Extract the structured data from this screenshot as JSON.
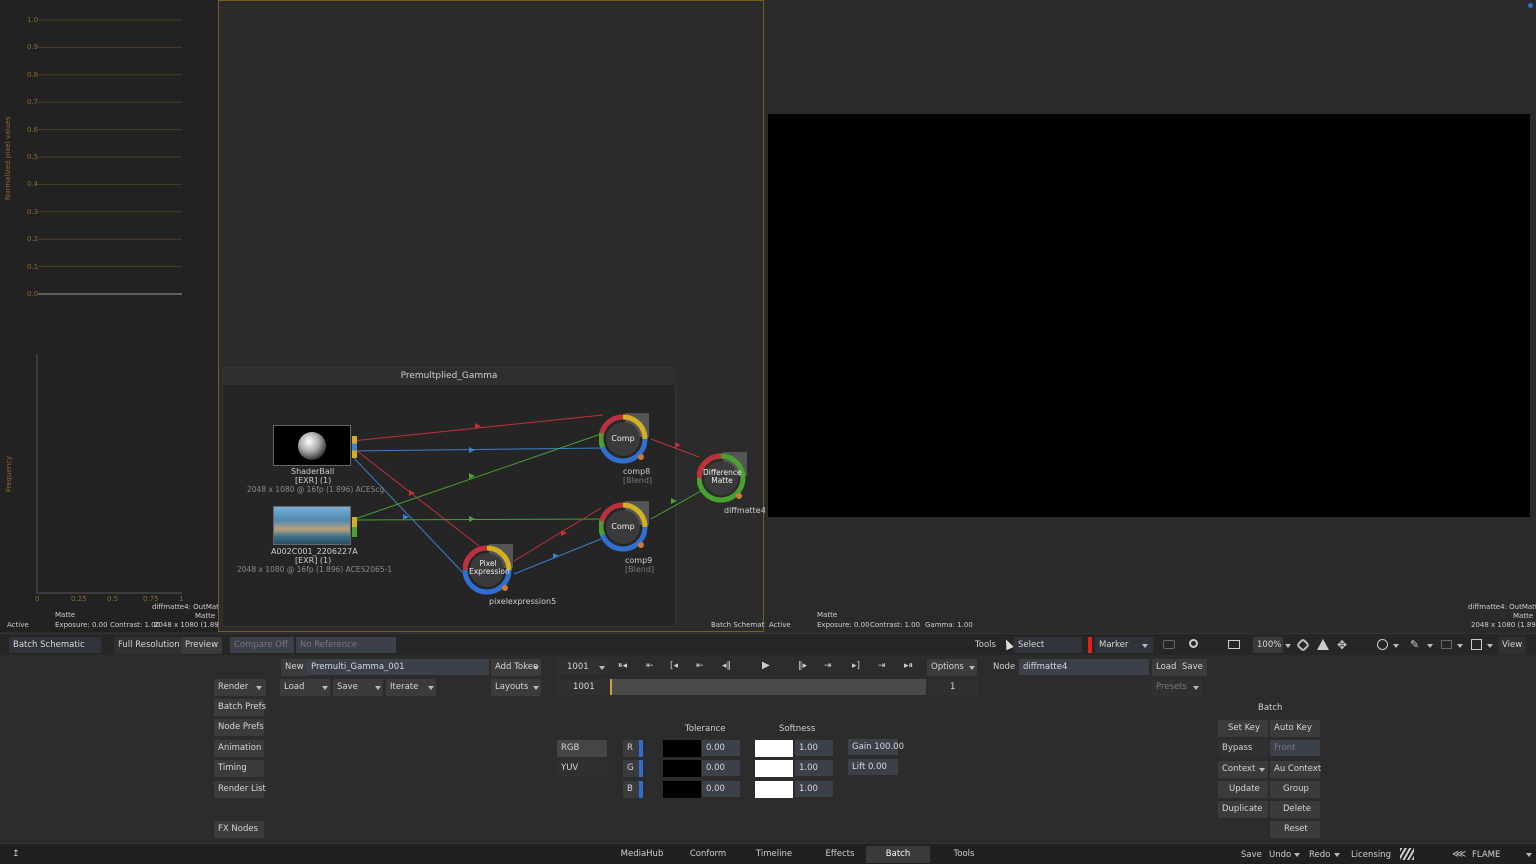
{
  "scopes": {
    "yaxis_title": "Normalized pixel values",
    "y_ticks": [
      "1.0",
      "0.9",
      "0.8",
      "0.7",
      "0.6",
      "0.5",
      "0.4",
      "0.3",
      "0.2",
      "0.1",
      "0.0"
    ],
    "freq_title": "Frequency",
    "x_ticks": [
      "0",
      "0.25",
      "0.5",
      "0.75",
      "1"
    ],
    "matte_label": "Matte",
    "node_info": "diffmatte4: OutMatte",
    "node_sub": "Matte",
    "status_active": "Active",
    "exposure": "Exposure: 0.00",
    "contrast": "Contrast: 1.00",
    "resolution": "2048 x 1080 (1.896)"
  },
  "schematic": {
    "group_title": "Premultplied_Gamma",
    "corner_label": "Batch Schematic",
    "nodes": {
      "shaderball": {
        "name": "ShaderBall",
        "format": "[EXR] (1)",
        "info": "2048 x 1080 @ 16fp (1.896) ACEScg"
      },
      "clip": {
        "name": "A002C001_2206227A",
        "format": "[EXR] (1)",
        "info": "2048 x 1080 @ 16fp (1.896) ACES2065-1"
      },
      "comp8": {
        "title": "Comp",
        "name": "comp8",
        "mode": "[Blend]"
      },
      "comp9": {
        "title": "Comp",
        "name": "comp9",
        "mode": "[Blend]"
      },
      "pixel": {
        "title": "Pixel Expression",
        "name": "pixelexpression5"
      },
      "diff": {
        "title": "Difference Matte",
        "name": "diffmatte4"
      }
    }
  },
  "viewer": {
    "status_active": "Active",
    "matte": "Matte",
    "exposure": "Exposure: 0.00",
    "contrast": "Contrast: 1.00",
    "gamma": "Gamma: 1.00",
    "node_info": "diffmatte4: OutMatte",
    "node_sub": "Matte",
    "resolution": "2048 x 1080 (1.896)"
  },
  "viewbar": {
    "batch_schematic": "Batch Schematic",
    "full_resolution": "Full Resolution",
    "preview": "Preview",
    "compare": "Compare Off",
    "reference": "No Reference",
    "tools": "Tools",
    "select": "Select",
    "marker": "Marker",
    "zoom": "100%",
    "view": "View"
  },
  "bottom": {
    "new": "New",
    "setup_name": "Premulti_Gamma_001",
    "add_token": "Add Token",
    "render": "Render",
    "load": "Load",
    "save": "Save",
    "iterate": "Iterate",
    "layouts": "Layouts",
    "frame": "1001",
    "frame_start": "1001",
    "frame_end": "1",
    "options": "Options",
    "node_label": "Node",
    "node_name": "diffmatte4",
    "node_load": "Load",
    "node_save": "Save",
    "presets": "Presets",
    "left_buttons": [
      "Batch Prefs",
      "Node Prefs",
      "Animation",
      "Timing",
      "Render List"
    ],
    "fx_nodes": "FX Nodes",
    "tolerance": "Tolerance",
    "softness": "Softness",
    "rgb": "RGB",
    "yuv": "YUV",
    "channels": [
      "R",
      "G",
      "B"
    ],
    "tol_values": [
      "0.00",
      "0.00",
      "0.00"
    ],
    "soft_values": [
      "1.00",
      "1.00",
      "1.00"
    ],
    "gain": "Gain 100.00",
    "lift": "Lift 0.00",
    "batch_title": "Batch",
    "set_key": "Set Key",
    "auto_key": "Auto Key",
    "bypass": "Bypass",
    "front": "Front",
    "context": "Context",
    "au_context": "Au Context",
    "update": "Update",
    "group": "Group",
    "duplicate": "Duplicate",
    "delete": "Delete",
    "reset": "Reset"
  },
  "footer": {
    "tabs": [
      "MediaHub",
      "Conform",
      "Timeline",
      "Effects",
      "Batch",
      "Tools"
    ],
    "active_tab": "Batch",
    "save": "Save",
    "undo": "Undo",
    "redo": "Redo",
    "licensing": "Licensing",
    "brand": "FLAME"
  },
  "colors": {
    "accent_blue": "#2f6fd0",
    "link_red": "#c0303a",
    "link_blue": "#3a7fc8",
    "link_green": "#4aa030",
    "frame_orange": "#7a5a25"
  }
}
